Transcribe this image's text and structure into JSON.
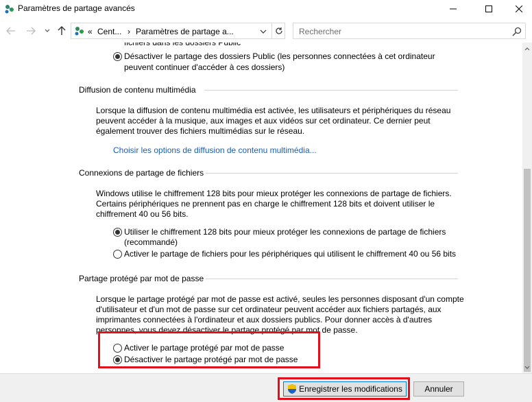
{
  "window": {
    "title": "Paramètres de partage avancés"
  },
  "address": {
    "overflow": "«",
    "crumb1": "Cent...",
    "crumb2": "Paramètres de partage a..."
  },
  "search": {
    "placeholder": "Rechercher"
  },
  "content": {
    "top_text_cut": "fichiers dans les dossiers Public",
    "public_off_line1": "Désactiver le partage des dossiers Public (les personnes connectées à cet ordinateur",
    "public_off_line2": "peuvent continuer d'accéder à ces dossiers)",
    "media": {
      "title": "Diffusion de contenu multimédia",
      "desc": [
        "Lorsque la diffusion de contenu multimédia est activée, les utilisateurs et périphériques du réseau",
        "peuvent accéder à la musique, aux images et aux vidéos sur cet ordinateur. Ce dernier peut",
        "également trouver des fichiers multimédias sur le réseau."
      ],
      "link": "Choisir les options de diffusion de contenu multimédia..."
    },
    "fileconn": {
      "title": "Connexions de partage de fichiers",
      "desc": [
        "Windows utilise le chiffrement 128 bits pour mieux protéger les connexions de partage de fichiers.",
        "Certains périphériques ne prennent pas en charge le chiffrement 128 bits et doivent utiliser le",
        "chiffrement 40 ou 56 bits."
      ],
      "opt1_line1": "Utiliser le chiffrement 128 bits pour mieux protéger les connexions de partage de fichiers",
      "opt1_line2": "(recommandé)",
      "opt2": "Activer le partage de fichiers pour les périphériques qui utilisent le chiffrement 40 ou 56 bits"
    },
    "password": {
      "title": "Partage protégé par mot de passe",
      "desc": [
        "Lorsque le partage protégé par mot de passe est activé, seules les personnes disposant d'un compte",
        "d'utilisateur et d'un mot de passe sur cet ordinateur peuvent accéder aux fichiers partagés, aux",
        "imprimantes connectées à l'ordinateur et aux dossiers publics. Pour donner accès à d'autres",
        "personnes, vous devez désactiver le partage protégé par mot de passe."
      ],
      "opt_on": "Activer le partage protégé par mot de passe",
      "opt_off": "Désactiver le partage protégé par mot de passe"
    }
  },
  "buttons": {
    "save": "Enregistrer les modifications",
    "cancel": "Annuler"
  },
  "icons": {
    "app": "network-share-icon",
    "shield": "uac-shield-icon"
  },
  "colors": {
    "highlight": "#e0101c",
    "link": "#1a5fb4"
  }
}
